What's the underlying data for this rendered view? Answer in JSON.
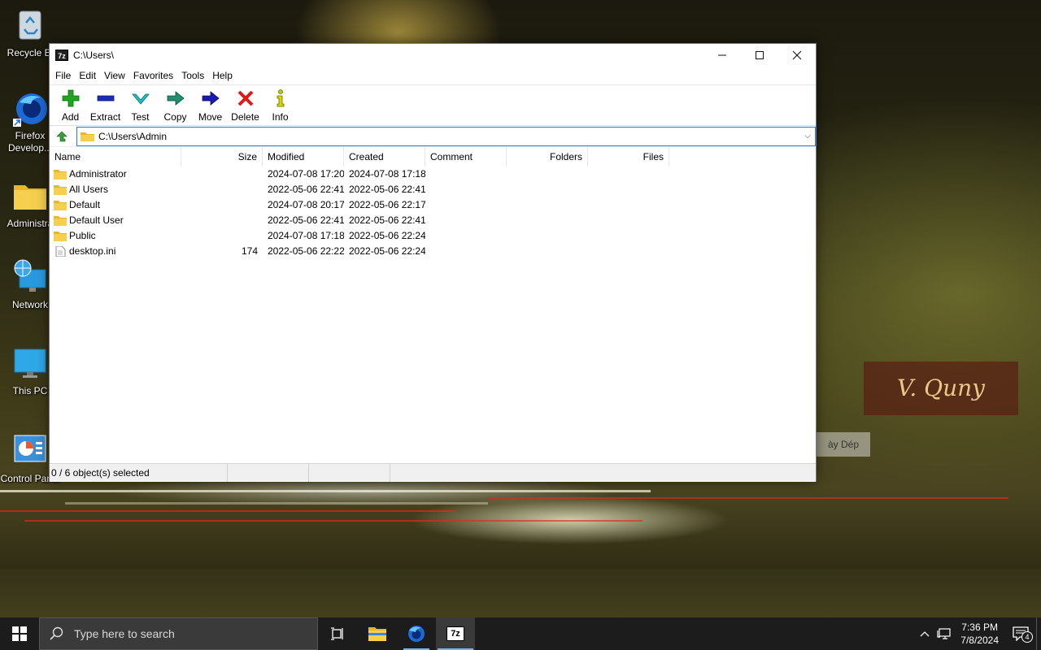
{
  "desktop": {
    "icons": [
      {
        "label": "Recycle Bi"
      },
      {
        "label": "Firefox Develop..."
      },
      {
        "label": "Administra"
      },
      {
        "label": "Network"
      },
      {
        "label": "This PC"
      },
      {
        "label": "Control Panel"
      }
    ],
    "sign_text": "V. Quny",
    "sign_text2": "ày Dép"
  },
  "window": {
    "title": "C:\\Users\\",
    "app_icon_text": "7z",
    "menu": [
      "File",
      "Edit",
      "View",
      "Favorites",
      "Tools",
      "Help"
    ],
    "toolbar": [
      {
        "label": "Add",
        "icon": "add-icon",
        "color": "#1fa51f"
      },
      {
        "label": "Extract",
        "icon": "extract-icon",
        "color": "#1a2db8"
      },
      {
        "label": "Test",
        "icon": "test-icon",
        "color": "#18a5a5"
      },
      {
        "label": "Copy",
        "icon": "copy-icon",
        "color": "#1f8f70"
      },
      {
        "label": "Move",
        "icon": "move-icon",
        "color": "#1a1ab0"
      },
      {
        "label": "Delete",
        "icon": "delete-icon",
        "color": "#e01818"
      },
      {
        "label": "Info",
        "icon": "info-icon",
        "color": "#c8c800"
      }
    ],
    "address": "C:\\Users\\Admin",
    "columns": {
      "name": "Name",
      "size": "Size",
      "modified": "Modified",
      "created": "Created",
      "comment": "Comment",
      "folders": "Folders",
      "files": "Files"
    },
    "rows": [
      {
        "name": "Administrator",
        "size": "",
        "modified": "2024-07-08 17:20",
        "created": "2024-07-08 17:18",
        "type": "folder"
      },
      {
        "name": "All Users",
        "size": "",
        "modified": "2022-05-06 22:41",
        "created": "2022-05-06 22:41",
        "type": "folder"
      },
      {
        "name": "Default",
        "size": "",
        "modified": "2024-07-08 20:17",
        "created": "2022-05-06 22:17",
        "type": "folder"
      },
      {
        "name": "Default User",
        "size": "",
        "modified": "2022-05-06 22:41",
        "created": "2022-05-06 22:41",
        "type": "folder"
      },
      {
        "name": "Public",
        "size": "",
        "modified": "2024-07-08 17:18",
        "created": "2022-05-06 22:24",
        "type": "folder"
      },
      {
        "name": "desktop.ini",
        "size": "174",
        "modified": "2022-05-06 22:22",
        "created": "2022-05-06 22:24",
        "type": "file"
      }
    ],
    "status": "0 / 6 object(s) selected"
  },
  "taskbar": {
    "search_placeholder": "Type here to search",
    "clock_time": "7:36 PM",
    "clock_date": "7/8/2024",
    "notification_count": "4",
    "sevenzip_label": "7z"
  },
  "colors": {
    "accent": "#2b7bd6",
    "folder": "#f3c540",
    "taskbar": "#1c1c1c"
  }
}
